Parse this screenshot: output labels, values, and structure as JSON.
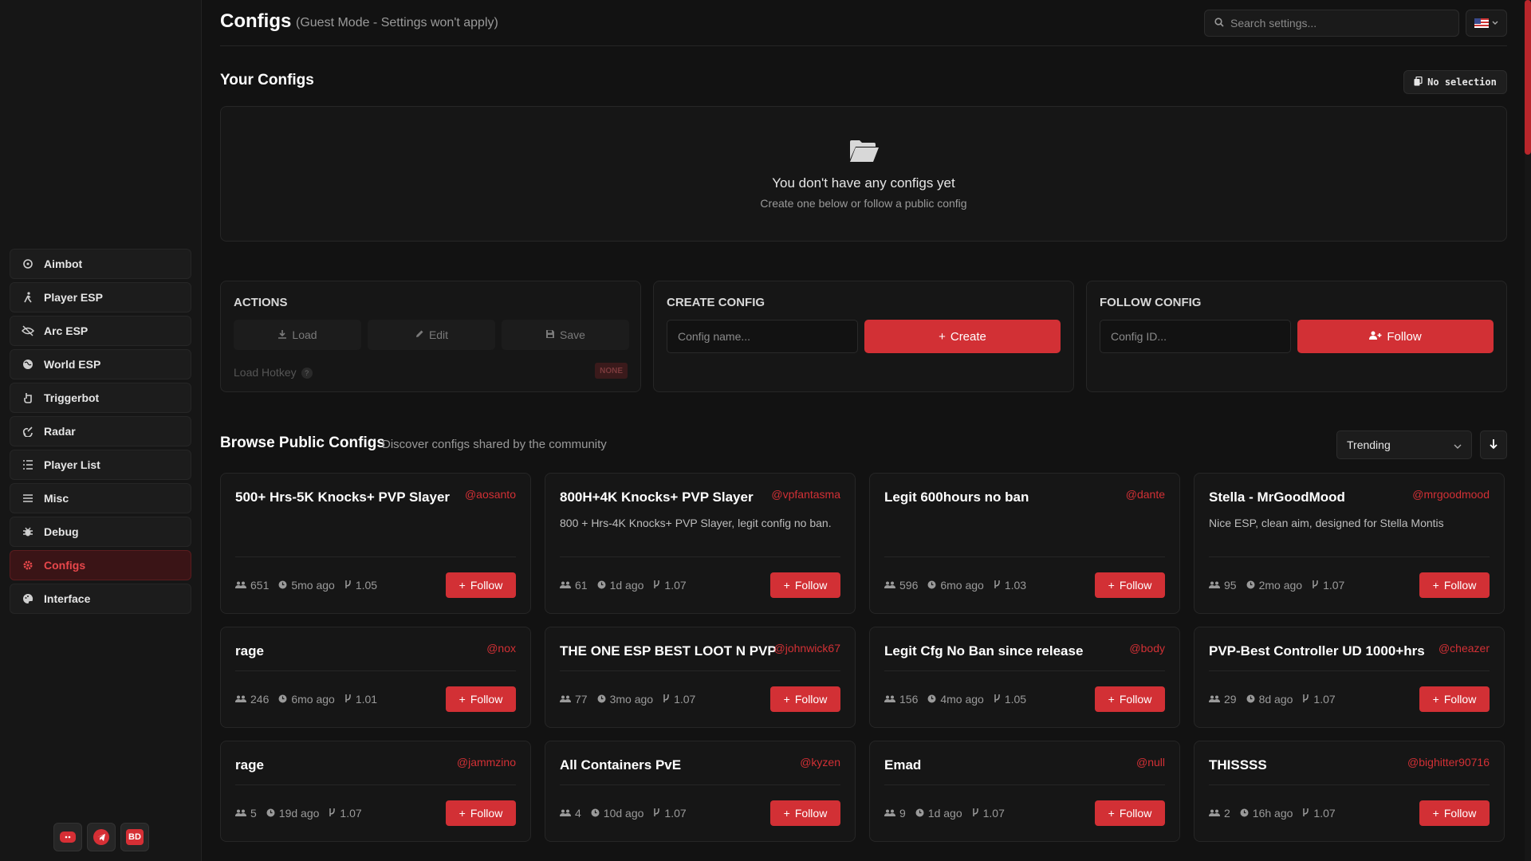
{
  "sidebar": {
    "items": [
      {
        "label": "Aimbot",
        "icon": "crosshair-icon"
      },
      {
        "label": "Player ESP",
        "icon": "running-person-icon"
      },
      {
        "label": "Arc ESP",
        "icon": "eye-slash-icon"
      },
      {
        "label": "World ESP",
        "icon": "globe-icon"
      },
      {
        "label": "Triggerbot",
        "icon": "hand-pointer-icon"
      },
      {
        "label": "Radar",
        "icon": "radar-icon"
      },
      {
        "label": "Player List",
        "icon": "list-icon"
      },
      {
        "label": "Misc",
        "icon": "menu-icon"
      },
      {
        "label": "Debug",
        "icon": "bug-icon"
      },
      {
        "label": "Configs",
        "icon": "gear-icon",
        "active": true
      },
      {
        "label": "Interface",
        "icon": "palette-icon"
      }
    ],
    "social": {
      "discord": "discord-icon",
      "telegram": "telegram-icon",
      "bd_label": "BD"
    }
  },
  "header": {
    "title": "Configs",
    "subtitle": "(Guest Mode - Settings won't apply)",
    "search_placeholder": "Search settings..."
  },
  "your_configs": {
    "title": "Your Configs",
    "selection_label": "No selection",
    "empty_title": "You don't have any configs yet",
    "empty_subtitle": "Create one below or follow a public config"
  },
  "actions": {
    "title": "ACTIONS",
    "load": "Load",
    "edit": "Edit",
    "save": "Save",
    "hotkey_label": "Load Hotkey",
    "hotkey_help": "?",
    "hotkey_value": "NONE"
  },
  "create_config": {
    "title": "CREATE CONFIG",
    "placeholder": "Config name...",
    "button": "Create"
  },
  "follow_config": {
    "title": "FOLLOW CONFIG",
    "placeholder": "Config ID...",
    "button": "Follow"
  },
  "browse": {
    "title": "Browse Public Configs",
    "subtitle": "Discover configs shared by the community",
    "sort": "Trending",
    "follow_label": "Follow",
    "cards": [
      {
        "title": "500+ Hrs-5K Knocks+ PVP Slayer",
        "author": "@aosanto",
        "desc": "",
        "followers": "651",
        "time": "5mo ago",
        "forks": "1.05"
      },
      {
        "title": "800H+4K Knocks+ PVP Slayer",
        "author": "@vpfantasma",
        "desc": "800 + Hrs-4K Knocks+ PVP Slayer, legit config no ban.",
        "followers": "61",
        "time": "1d ago",
        "forks": "1.07"
      },
      {
        "title": "Legit 600hours no ban",
        "author": "@dante",
        "desc": "",
        "followers": "596",
        "time": "6mo ago",
        "forks": "1.03"
      },
      {
        "title": "Stella - MrGoodMood",
        "author": "@mrgoodmood",
        "desc": "Nice ESP, clean aim, designed for Stella Montis",
        "followers": "95",
        "time": "2mo ago",
        "forks": "1.07"
      },
      {
        "title": "rage",
        "author": "@nox",
        "desc": "",
        "followers": "246",
        "time": "6mo ago",
        "forks": "1.01"
      },
      {
        "title": "THE ONE ESP BEST LOOT N PVP",
        "author": "@johnwick67",
        "desc": "",
        "followers": "77",
        "time": "3mo ago",
        "forks": "1.07"
      },
      {
        "title": "Legit Cfg No Ban since release",
        "author": "@body",
        "desc": "",
        "followers": "156",
        "time": "4mo ago",
        "forks": "1.05"
      },
      {
        "title": "PVP-Best Controller UD 1000+hrs",
        "author": "@cheazer",
        "desc": "",
        "followers": "29",
        "time": "8d ago",
        "forks": "1.07"
      },
      {
        "title": "rage",
        "author": "@jammzino",
        "desc": "",
        "followers": "5",
        "time": "19d ago",
        "forks": "1.07"
      },
      {
        "title": "All Containers PvE",
        "author": "@kyzen",
        "desc": "",
        "followers": "4",
        "time": "10d ago",
        "forks": "1.07"
      },
      {
        "title": "Emad",
        "author": "@null",
        "desc": "",
        "followers": "9",
        "time": "1d ago",
        "forks": "1.07"
      },
      {
        "title": "THISSSS",
        "author": "@bighitter90716",
        "desc": "",
        "followers": "2",
        "time": "16h ago",
        "forks": "1.07"
      }
    ]
  },
  "colors": {
    "accent": "#d23035",
    "background": "#121212",
    "panel": "#161616"
  }
}
